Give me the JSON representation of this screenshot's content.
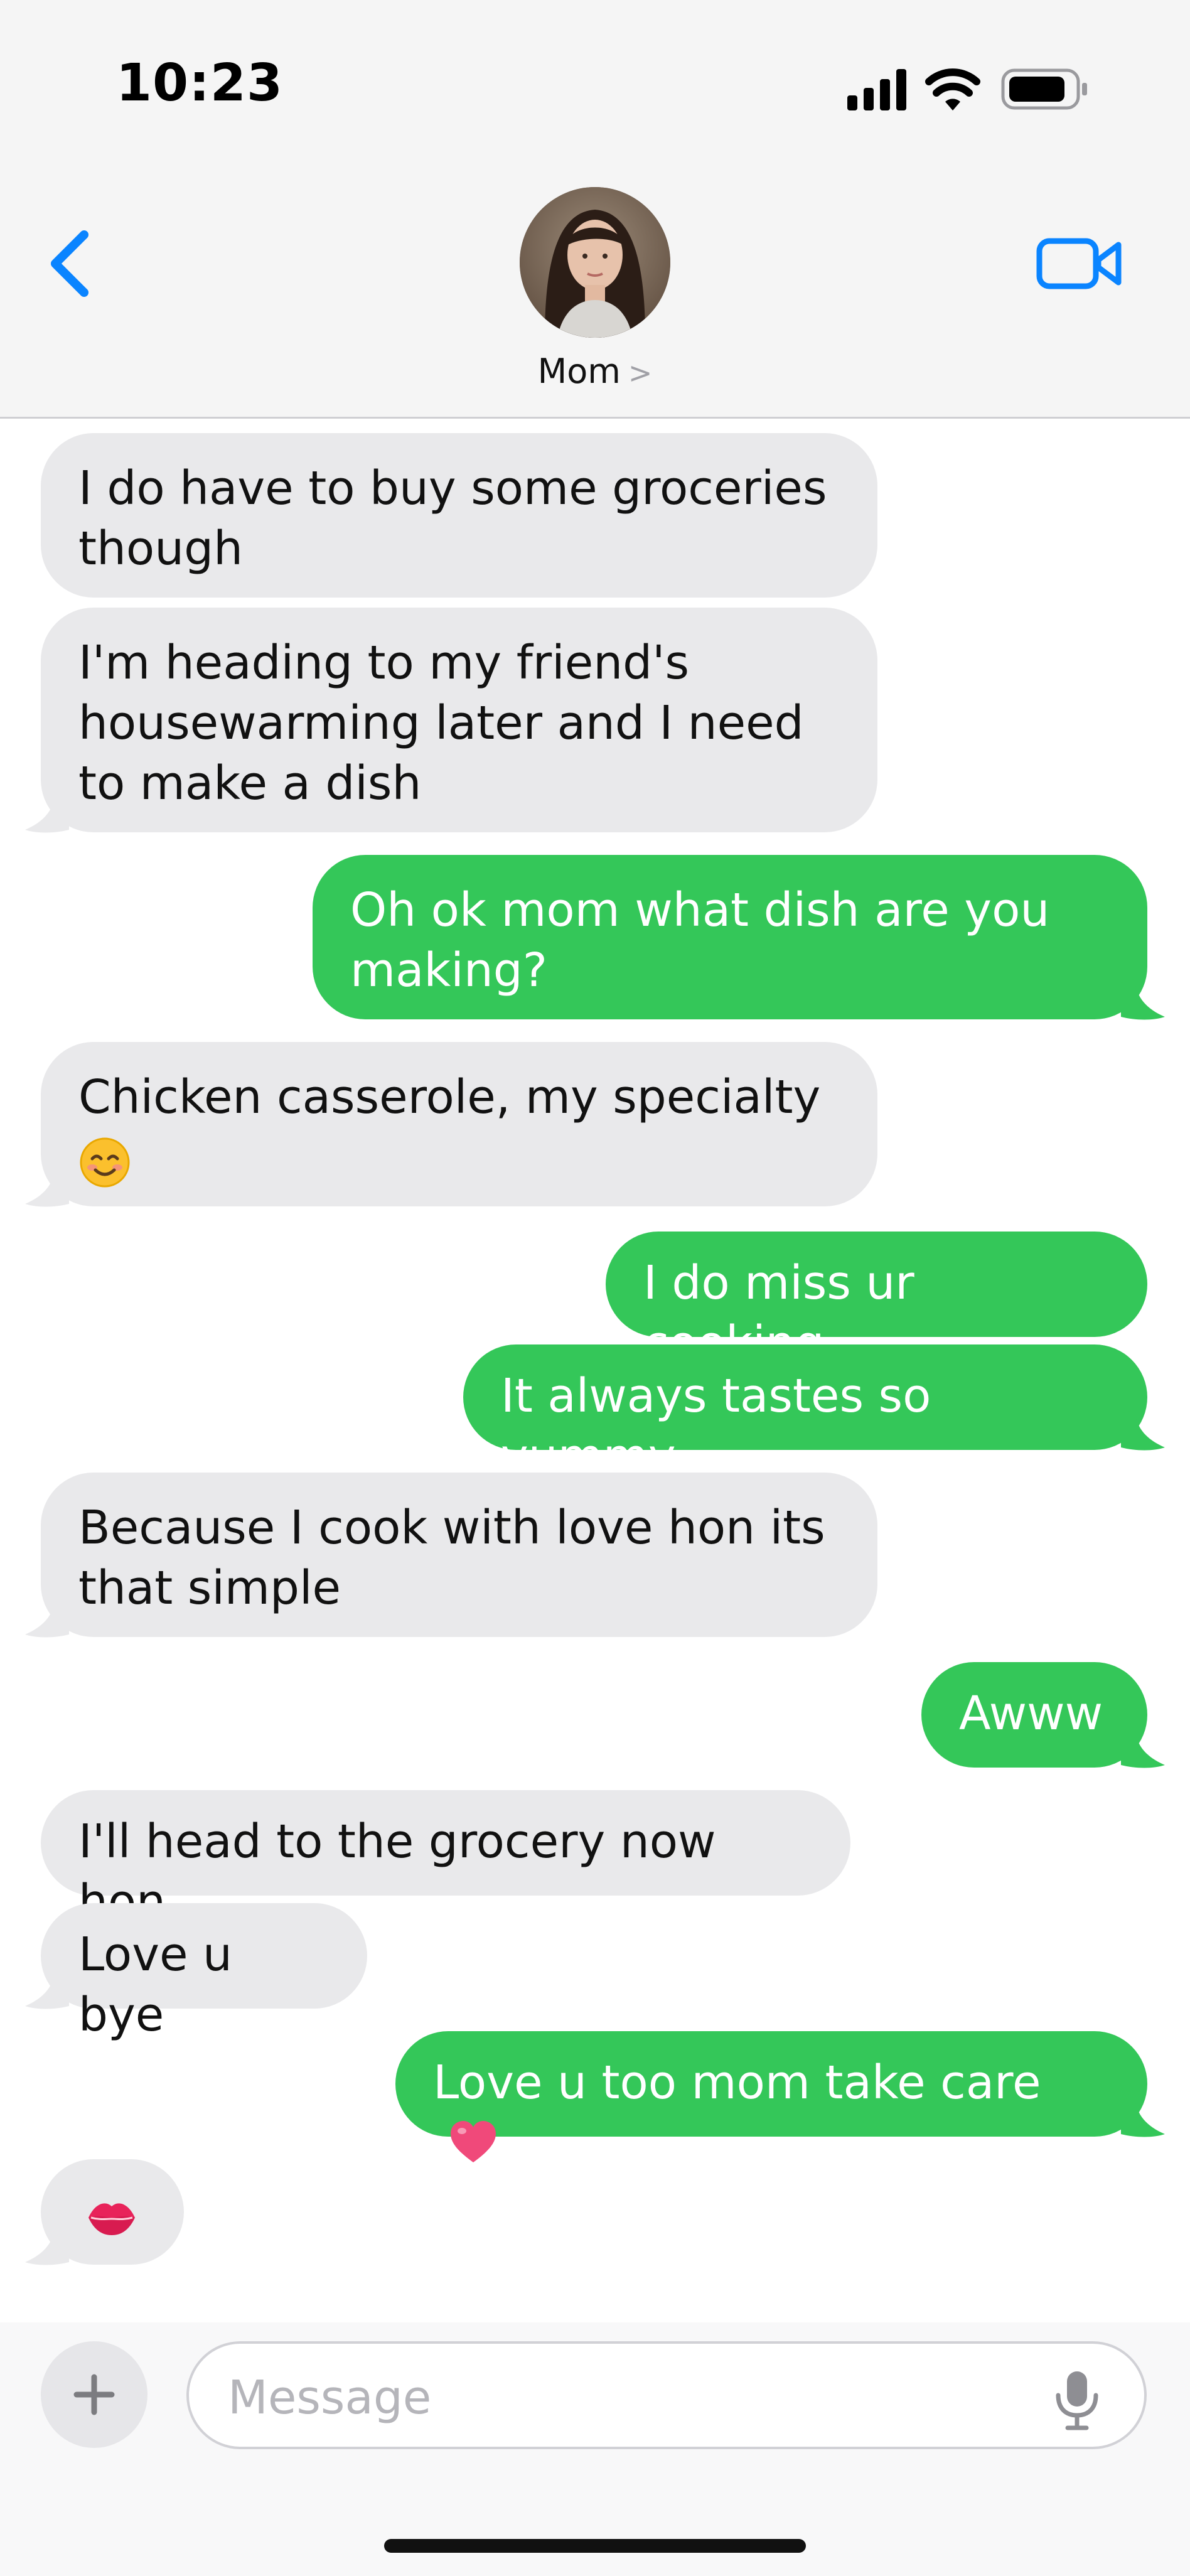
{
  "status_bar": {
    "time": "10:23"
  },
  "header": {
    "contact_name": "Mom",
    "name_chevron": ">"
  },
  "messages": [
    {
      "from": "them",
      "lines": [
        "I do have to buy some groceries",
        "though"
      ]
    },
    {
      "from": "them",
      "lines": [
        "I'm heading to my friend's",
        "housewarming later and I need",
        "to make a dish"
      ]
    },
    {
      "from": "me",
      "lines": [
        "Oh ok mom what dish are you",
        "making?"
      ]
    },
    {
      "from": "them",
      "lines": [
        "Chicken casserole, my specialty"
      ],
      "emoji": "smiling-face-with-smiling-eyes"
    },
    {
      "from": "me",
      "lines": [
        "I do miss ur cooking"
      ]
    },
    {
      "from": "me",
      "lines": [
        "It always tastes so yummy"
      ]
    },
    {
      "from": "them",
      "lines": [
        "Because I cook with love hon its",
        "that simple"
      ]
    },
    {
      "from": "me",
      "lines": [
        "Awww"
      ]
    },
    {
      "from": "them",
      "lines": [
        "I'll head to the grocery now hon"
      ]
    },
    {
      "from": "them",
      "lines": [
        "Love u bye"
      ]
    },
    {
      "from": "me",
      "lines": [
        "Love u too mom take care"
      ],
      "emoji": "pink-heart"
    },
    {
      "from": "them",
      "lines": [],
      "emoji": "kiss-mark"
    }
  ],
  "composer": {
    "placeholder": "Message"
  },
  "colors": {
    "incoming": "#e9e9eb",
    "outgoing": "#34c759",
    "accent": "#0a84ff"
  }
}
